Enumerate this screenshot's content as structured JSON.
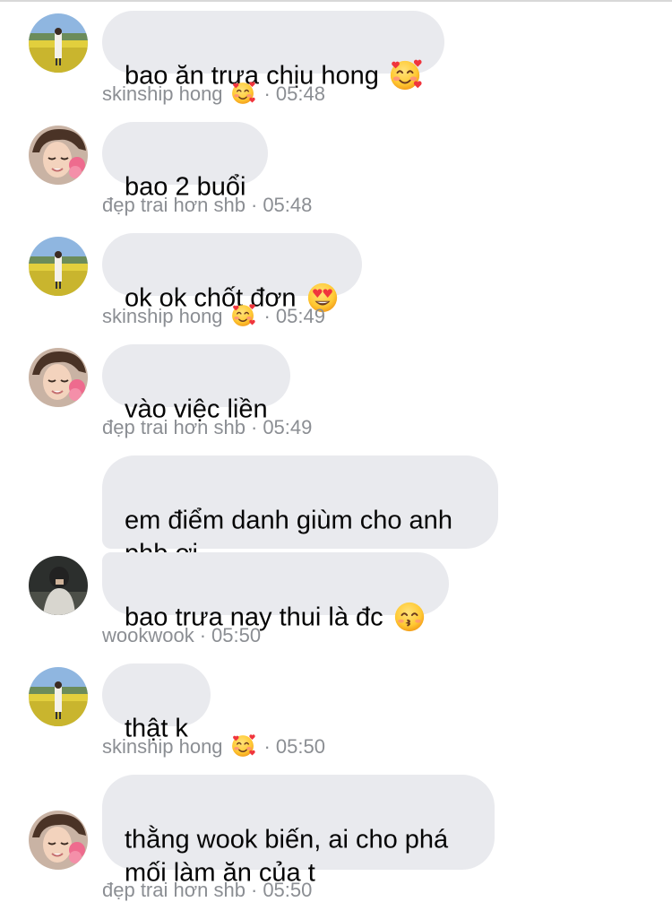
{
  "messages": [
    {
      "text": "bao ăn trưa chịu hong",
      "emoji": "smiling-face-with-hearts"
    },
    {
      "text": "bao 2 buổi",
      "emoji": ""
    },
    {
      "text": "ok ok chốt đơn",
      "emoji": "heart-eyes"
    },
    {
      "text": "vào việc liền",
      "emoji": ""
    },
    {
      "text": "em điểm danh giùm cho anh\nphb ơi",
      "emoji": ""
    },
    {
      "text": "bao trưa nay thui là đc",
      "emoji": "kissing-face"
    },
    {
      "text": "thật k",
      "emoji": ""
    },
    {
      "text": "thằng wook biến, ai cho phá\nmối làm ăn của t",
      "emoji": ""
    }
  ],
  "meta": [
    {
      "name": "skinship hong",
      "emoji": "smiling-face-with-hearts",
      "separator": "·",
      "time": "05:48"
    },
    {
      "name": "đẹp trai hơn shb",
      "emoji": "",
      "separator": "·",
      "time": "05:48"
    },
    {
      "name": "skinship hong",
      "emoji": "smiling-face-with-hearts",
      "separator": "·",
      "time": "05:49"
    },
    {
      "name": "đẹp trai hơn shb",
      "emoji": "",
      "separator": "·",
      "time": "05:49"
    },
    {
      "name": "wookwook",
      "emoji": "",
      "separator": "·",
      "time": "05:50"
    },
    {
      "name": "skinship hong",
      "emoji": "smiling-face-with-hearts",
      "separator": "·",
      "time": "05:50"
    },
    {
      "name": "đẹp trai hơn shb",
      "emoji": "",
      "separator": "·",
      "time": "05:50"
    }
  ],
  "colors": {
    "bubble": "#e9eaee",
    "meta_text": "#8b8e93",
    "text": "#050505"
  }
}
